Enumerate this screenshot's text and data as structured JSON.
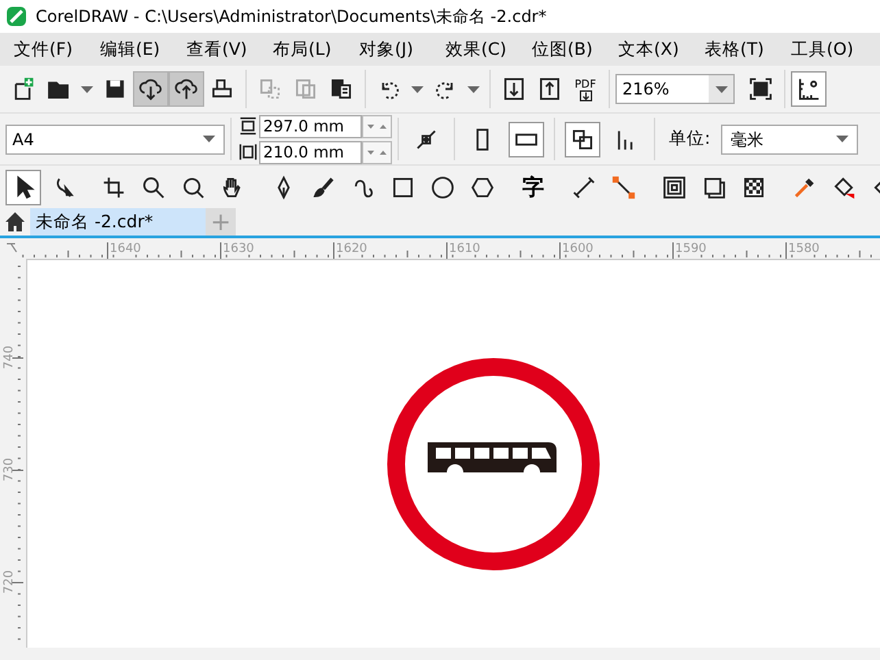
{
  "window": {
    "title": "CorelDRAW - C:\\Users\\Administrator\\Documents\\未命名 -2.cdr*"
  },
  "menu": [
    "文件(F)",
    "编辑(E)",
    "查看(V)",
    "布局(L)",
    "对象(J)",
    "效果(C)",
    "位图(B)",
    "文本(X)",
    "表格(T)",
    "工具(O)"
  ],
  "standard_toolbar": {
    "buttons": [
      {
        "pressed": false,
        "disabled": false
      },
      {
        "pressed": false,
        "disabled": false
      },
      {
        "pressed": false,
        "disabled": false
      },
      {
        "pressed": true,
        "disabled": false
      },
      {
        "pressed": true,
        "disabled": false
      },
      {
        "pressed": false,
        "disabled": false
      },
      {
        "pressed": false,
        "disabled": true
      },
      {
        "pressed": false,
        "disabled": true
      },
      {
        "pressed": false,
        "disabled": false
      },
      {
        "pressed": false,
        "disabled": false
      },
      {
        "pressed": false,
        "disabled": false
      },
      {
        "pressed": false,
        "disabled": false
      },
      {
        "pressed": false,
        "disabled": false
      }
    ],
    "pdf_label": "PDF",
    "zoom": "216%"
  },
  "property_bar": {
    "page_size": "A4",
    "width": "297.0 mm",
    "height": "210.0 mm",
    "units_label": "单位:",
    "units": "毫米"
  },
  "toolbox": [
    {
      "selected": true
    },
    {
      "selected": false
    },
    {
      "selected": false
    },
    {
      "selected": false
    },
    {
      "selected": false
    },
    {
      "selected": false
    },
    {
      "selected": false
    },
    {
      "selected": false
    },
    {
      "selected": false
    },
    {
      "selected": false
    },
    {
      "selected": false
    },
    {
      "selected": false
    },
    {
      "selected": false
    },
    {
      "selected": false
    },
    {
      "selected": false
    },
    {
      "selected": false
    },
    {
      "selected": false
    },
    {
      "selected": false
    },
    {
      "selected": false
    },
    {
      "selected": false
    },
    {
      "selected": false
    }
  ],
  "text_tool_glyph": "字",
  "tabs": [
    {
      "label": "未命名 -2.cdr*",
      "selected": true
    }
  ],
  "new_tab": "+",
  "horizontal_ruler": [
    "1640",
    "1630",
    "1620",
    "1610",
    "1600",
    "1590",
    "1580"
  ],
  "vertical_ruler": [
    "740",
    "730",
    "720"
  ]
}
